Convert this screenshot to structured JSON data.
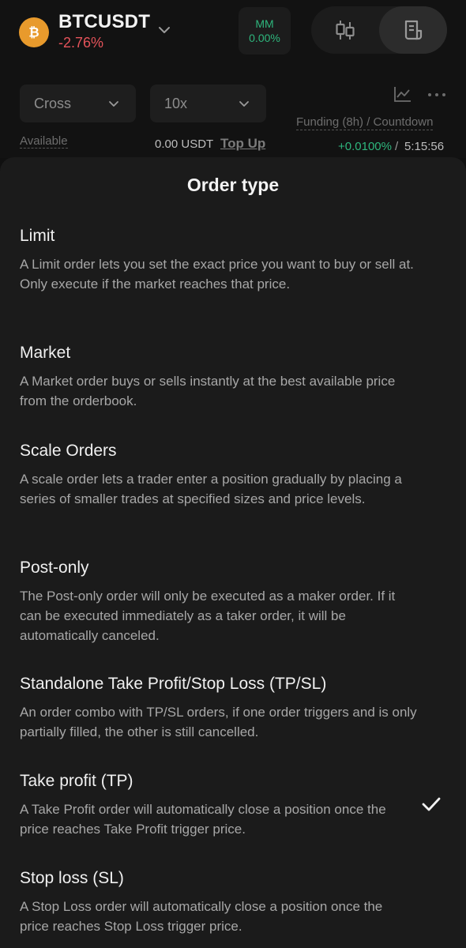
{
  "header": {
    "symbol": "BTCUSDT",
    "change": "-2.76%",
    "coin_icon": "bitcoin-icon",
    "mm_label": "MM",
    "mm_value": "0.00%",
    "segment_icons": [
      "candlestick-chart-icon",
      "order-book-icon"
    ],
    "colors": {
      "positive": "#2eb67d",
      "negative": "#e4535a",
      "coin": "#e89a2c"
    }
  },
  "controls": {
    "margin_mode": "Cross",
    "leverage": "10x",
    "available_label": "Available",
    "available_value": "0.00 USDT",
    "top_up": "Top Up",
    "funding_label": "Funding (8h) / Countdown",
    "funding_rate": "+0.0100%",
    "funding_separator": " /",
    "countdown": "5:15:56"
  },
  "sheet": {
    "title": "Order type",
    "options": [
      {
        "title": "Limit",
        "description": "A Limit order lets you set the exact price you want to buy or sell at. Only execute if the market reaches that price.",
        "selected": false
      },
      {
        "title": "Market",
        "description": "A Market order buys or sells instantly at the best available price from the orderbook.",
        "selected": false
      },
      {
        "title": "Scale Orders",
        "description": "A scale order lets a trader enter a position gradually by placing a series of smaller trades at specified sizes and price levels.",
        "selected": false
      },
      {
        "title": "Post-only",
        "description": "The Post-only order will only be executed as a maker order. If it can be executed immediately as a taker order, it will be automatically canceled.",
        "selected": false
      },
      {
        "title": "Standalone Take Profit/Stop Loss (TP/SL)",
        "description": "An order combo with TP/SL orders, if one order triggers and is only partially filled, the other is still cancelled.",
        "selected": false
      },
      {
        "title": "Take profit (TP)",
        "description": "A Take Profit order will automatically close a position once the price reaches Take Profit trigger price.",
        "selected": true
      },
      {
        "title": "Stop loss (SL)",
        "description": "A Stop Loss order will automatically close a position once the price reaches Stop Loss trigger price.",
        "selected": false
      }
    ]
  }
}
